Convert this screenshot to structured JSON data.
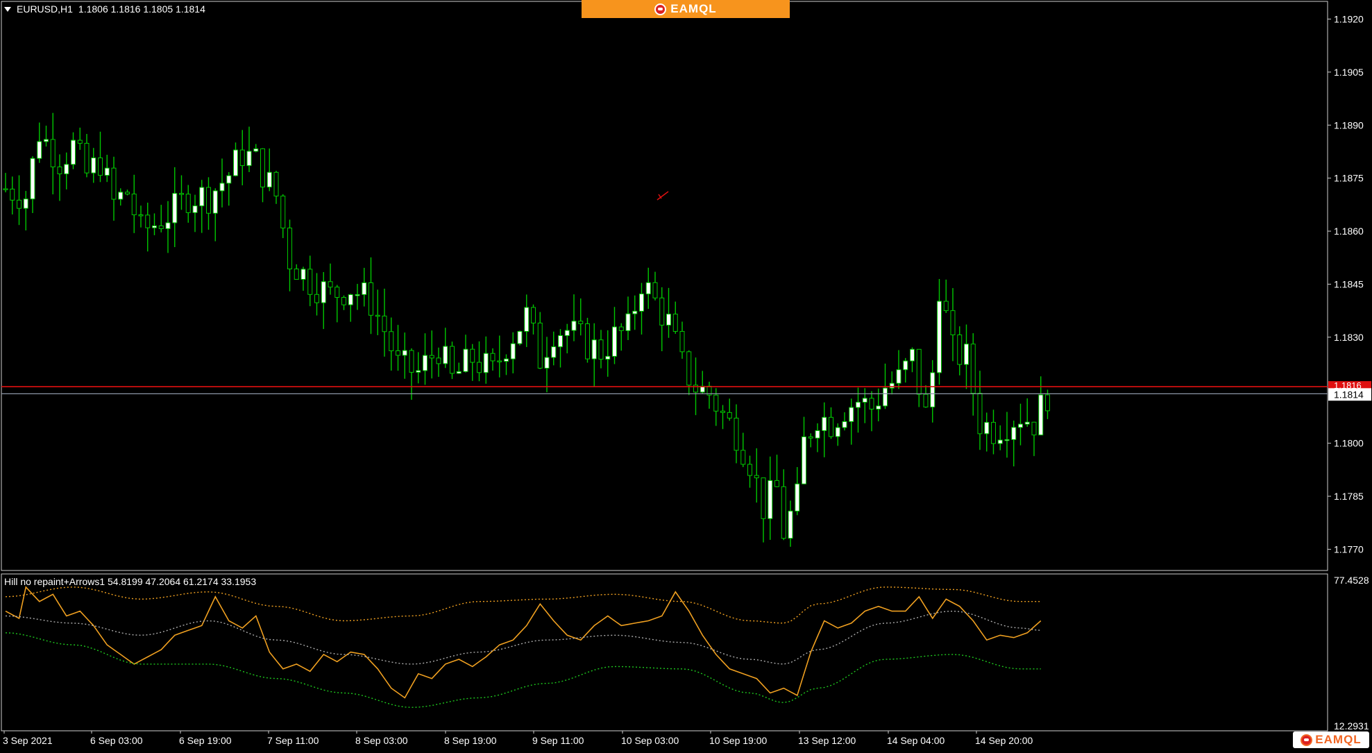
{
  "header": {
    "symbol": "EURUSD,H1",
    "ohlc": "1.1806 1.1816 1.1805 1.1814"
  },
  "banner": {
    "brand": "EAMQL"
  },
  "corner_brand": "EAMQL",
  "indicator": {
    "label": "Hill no repaint+Arrows1 54.8199 47.2064 61.2174 33.1953"
  },
  "price_axis": {
    "ticks": [
      "1.1920",
      "1.1905",
      "1.1890",
      "1.1875",
      "1.1860",
      "1.1845",
      "1.1830",
      "1.1800",
      "1.1785",
      "1.1770"
    ],
    "bid_label": "1.1814",
    "red_label": "1.1816"
  },
  "indicator_axis": {
    "max_label": "77.4528",
    "min_label": "12.2931"
  },
  "time_axis": {
    "labels": [
      "3 Sep 2021",
      "6 Sep 03:00",
      "6 Sep 19:00",
      "7 Sep 11:00",
      "8 Sep 03:00",
      "8 Sep 19:00",
      "9 Sep 11:00",
      "10 Sep 03:00",
      "10 Sep 19:00",
      "13 Sep 12:00",
      "14 Sep 04:00",
      "14 Sep 20:00"
    ]
  },
  "colors": {
    "background": "#000000",
    "bull_fill": "#ffffff",
    "wick": "#00c800",
    "bear_fill": "#000000",
    "red_line": "#e01010",
    "bid_line": "#8c96a8",
    "osc_line": "#f0a020",
    "band_upper": "#f0a020",
    "band_lower": "#1ec81e",
    "mid_line": "#aaaaaa",
    "banner": "#f7941d"
  },
  "chart_data": [
    {
      "type": "candlestick",
      "title": "EURUSD,H1",
      "ylim": [
        1.1764,
        1.1925
      ],
      "red_line_price": 1.1816,
      "bid_price": 1.1814,
      "x_labels": [
        "3 Sep 2021",
        "6 Sep 03:00",
        "6 Sep 19:00",
        "7 Sep 11:00",
        "8 Sep 03:00",
        "8 Sep 19:00",
        "9 Sep 11:00",
        "10 Sep 03:00",
        "10 Sep 19:00",
        "13 Sep 12:00",
        "14 Sep 04:00",
        "14 Sep 20:00"
      ],
      "close_path": [
        [
          0,
          1.1872
        ],
        [
          3,
          1.187
        ],
        [
          5,
          1.1888
        ],
        [
          8,
          1.188
        ],
        [
          10,
          1.1884
        ],
        [
          12,
          1.1876
        ],
        [
          14,
          1.188
        ],
        [
          16,
          1.1868
        ],
        [
          18,
          1.1871
        ],
        [
          20,
          1.186
        ],
        [
          22,
          1.1862
        ],
        [
          25,
          1.1866
        ],
        [
          27,
          1.187
        ],
        [
          30,
          1.187
        ],
        [
          33,
          1.1876
        ],
        [
          35,
          1.1882
        ],
        [
          37,
          1.188
        ],
        [
          40,
          1.187
        ],
        [
          42,
          1.1852
        ],
        [
          45,
          1.1846
        ],
        [
          48,
          1.1842
        ],
        [
          51,
          1.1844
        ],
        [
          54,
          1.184
        ],
        [
          56,
          1.1832
        ],
        [
          58,
          1.1822
        ],
        [
          61,
          1.182
        ],
        [
          64,
          1.1827
        ],
        [
          66,
          1.1818
        ],
        [
          69,
          1.1824
        ],
        [
          72,
          1.182
        ],
        [
          74,
          1.1828
        ],
        [
          77,
          1.1836
        ],
        [
          79,
          1.1824
        ],
        [
          81,
          1.1832
        ],
        [
          83,
          1.1832
        ],
        [
          86,
          1.1828
        ],
        [
          88,
          1.1826
        ],
        [
          90,
          1.183
        ],
        [
          92,
          1.1832
        ],
        [
          94,
          1.1846
        ],
        [
          96,
          1.184
        ],
        [
          98,
          1.1834
        ],
        [
          100,
          1.1822
        ],
        [
          102,
          1.1816
        ],
        [
          104,
          1.1814
        ],
        [
          106,
          1.1808
        ],
        [
          108,
          1.1803
        ],
        [
          110,
          1.1795
        ],
        [
          112,
          1.1782
        ],
        [
          114,
          1.1787
        ],
        [
          115,
          1.1775
        ],
        [
          117,
          1.1784
        ],
        [
          118,
          1.18
        ],
        [
          120,
          1.1808
        ],
        [
          122,
          1.1806
        ],
        [
          124,
          1.181
        ],
        [
          126,
          1.1812
        ],
        [
          128,
          1.181
        ],
        [
          130,
          1.1816
        ],
        [
          132,
          1.1818
        ],
        [
          134,
          1.1824
        ],
        [
          136,
          1.1808
        ],
        [
          137,
          1.182
        ],
        [
          138,
          1.1845
        ],
        [
          140,
          1.1826
        ],
        [
          142,
          1.1824
        ],
        [
          144,
          1.1806
        ],
        [
          146,
          1.1804
        ],
        [
          148,
          1.1806
        ],
        [
          150,
          1.1808
        ],
        [
          152,
          1.1806
        ],
        [
          154,
          1.1814
        ]
      ]
    },
    {
      "type": "line",
      "title": "Hill no repaint+Arrows1",
      "ylim": [
        12.2931,
        77.4528
      ],
      "series": [
        {
          "name": "Hill",
          "color": "#f0a020",
          "points": [
            [
              0,
              62
            ],
            [
              2,
              59
            ],
            [
              3,
              72
            ],
            [
              5,
              66
            ],
            [
              7,
              69
            ],
            [
              9,
              60
            ],
            [
              11,
              62
            ],
            [
              13,
              56
            ],
            [
              15,
              48
            ],
            [
              17,
              44
            ],
            [
              19,
              40
            ],
            [
              21,
              43
            ],
            [
              23,
              46
            ],
            [
              25,
              52
            ],
            [
              27,
              54
            ],
            [
              29,
              56
            ],
            [
              31,
              68
            ],
            [
              33,
              58
            ],
            [
              35,
              55
            ],
            [
              37,
              60
            ],
            [
              39,
              45
            ],
            [
              41,
              38
            ],
            [
              43,
              40
            ],
            [
              45,
              37
            ],
            [
              47,
              44
            ],
            [
              49,
              41
            ],
            [
              51,
              45
            ],
            [
              53,
              44
            ],
            [
              55,
              38
            ],
            [
              57,
              30
            ],
            [
              59,
              26
            ],
            [
              61,
              36
            ],
            [
              63,
              34
            ],
            [
              65,
              40
            ],
            [
              67,
              42
            ],
            [
              69,
              39
            ],
            [
              71,
              43
            ],
            [
              73,
              48
            ],
            [
              75,
              50
            ],
            [
              77,
              56
            ],
            [
              79,
              65
            ],
            [
              81,
              58
            ],
            [
              83,
              52
            ],
            [
              85,
              50
            ],
            [
              87,
              56
            ],
            [
              89,
              60
            ],
            [
              91,
              56
            ],
            [
              93,
              57
            ],
            [
              95,
              58
            ],
            [
              97,
              60
            ],
            [
              99,
              70
            ],
            [
              101,
              62
            ],
            [
              103,
              52
            ],
            [
              105,
              44
            ],
            [
              107,
              38
            ],
            [
              109,
              36
            ],
            [
              111,
              34
            ],
            [
              113,
              28
            ],
            [
              115,
              30
            ],
            [
              117,
              27
            ],
            [
              119,
              45
            ],
            [
              121,
              58
            ],
            [
              123,
              55
            ],
            [
              125,
              57
            ],
            [
              127,
              62
            ],
            [
              129,
              64
            ],
            [
              131,
              62
            ],
            [
              133,
              62
            ],
            [
              135,
              68
            ],
            [
              137,
              59
            ],
            [
              139,
              67
            ],
            [
              141,
              64
            ],
            [
              143,
              58
            ],
            [
              145,
              50
            ],
            [
              147,
              52
            ],
            [
              149,
              51
            ],
            [
              151,
              53
            ],
            [
              153,
              58
            ]
          ]
        },
        {
          "name": "Upper band",
          "color": "#f0a020",
          "points": [
            [
              0,
              68
            ],
            [
              10,
              72
            ],
            [
              20,
              67
            ],
            [
              30,
              70
            ],
            [
              40,
              64
            ],
            [
              50,
              58
            ],
            [
              60,
              60
            ],
            [
              70,
              66
            ],
            [
              80,
              67
            ],
            [
              90,
              69
            ],
            [
              100,
              66
            ],
            [
              110,
              58
            ],
            [
              115,
              57
            ],
            [
              120,
              65
            ],
            [
              130,
              72
            ],
            [
              140,
              71
            ],
            [
              150,
              66
            ],
            [
              153,
              66
            ]
          ]
        },
        {
          "name": "Middle",
          "color": "#aaaaaa",
          "points": [
            [
              0,
              60
            ],
            [
              10,
              57
            ],
            [
              20,
              52
            ],
            [
              30,
              58
            ],
            [
              40,
              50
            ],
            [
              50,
              44
            ],
            [
              60,
              40
            ],
            [
              70,
              45
            ],
            [
              80,
              50
            ],
            [
              90,
              52
            ],
            [
              100,
              49
            ],
            [
              110,
              42
            ],
            [
              115,
              40
            ],
            [
              120,
              46
            ],
            [
              130,
              57
            ],
            [
              140,
              62
            ],
            [
              150,
              55
            ],
            [
              153,
              54
            ]
          ]
        },
        {
          "name": "Lower band",
          "color": "#1ec81e",
          "points": [
            [
              0,
              53
            ],
            [
              10,
              48
            ],
            [
              20,
              40
            ],
            [
              30,
              40
            ],
            [
              40,
              34
            ],
            [
              50,
              28
            ],
            [
              60,
              22
            ],
            [
              70,
              26
            ],
            [
              80,
              32
            ],
            [
              90,
              39
            ],
            [
              100,
              38
            ],
            [
              110,
              28
            ],
            [
              115,
              24
            ],
            [
              120,
              30
            ],
            [
              130,
              42
            ],
            [
              140,
              44
            ],
            [
              150,
              38
            ],
            [
              153,
              38
            ]
          ]
        }
      ]
    }
  ]
}
